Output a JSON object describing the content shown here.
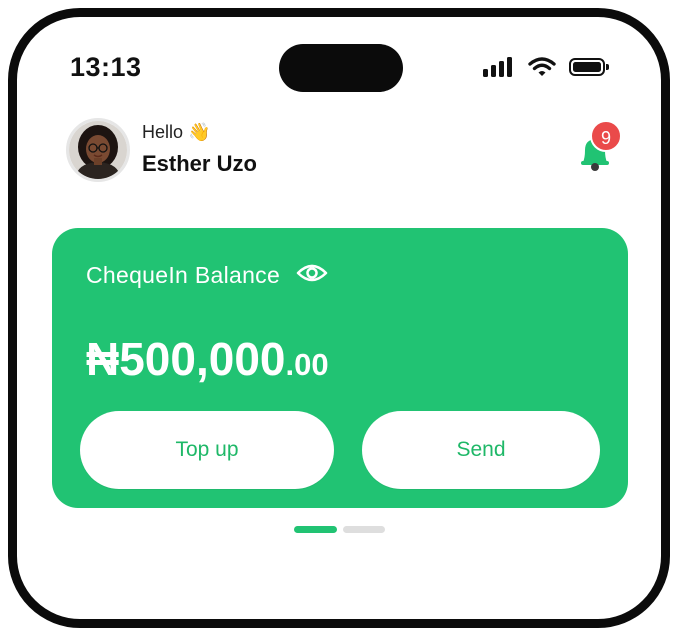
{
  "status_bar": {
    "time": "13:13"
  },
  "header": {
    "greeting": "Hello 👋",
    "user_name": "Esther Uzo",
    "notification_count": "9"
  },
  "balance_card": {
    "label": "ChequeIn  Balance",
    "amount_main": "₦500,000",
    "amount_decimal": ".00",
    "top_up_label": "Top up",
    "send_label": "Send"
  },
  "pager": {
    "active_index": 0,
    "count": 2
  },
  "colors": {
    "accent_green": "#21c373",
    "badge_red": "#ea4a4a",
    "text_dark": "#111111"
  },
  "icons": {
    "bell": "bell-icon",
    "eye": "eye-icon",
    "wifi": "wifi-icon",
    "battery": "battery-icon",
    "signal": "signal-icon"
  }
}
